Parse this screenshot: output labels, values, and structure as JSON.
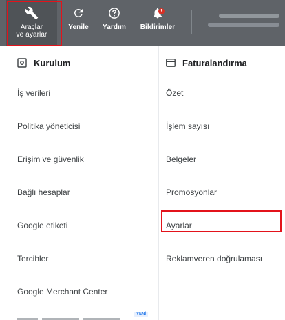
{
  "toolbar": {
    "tools_line1": "Araçlar",
    "tools_line2": "ve ayarlar",
    "refresh": "Yenile",
    "help": "Yardım",
    "notifications": "Bildirimler",
    "notification_badge": "!"
  },
  "left_panel": {
    "title": "Kurulum",
    "items": [
      "İş verileri",
      "Politika yöneticisi",
      "Erişim ve güvenlik",
      "Bağlı hesaplar",
      "Google etiketi",
      "Tercihler",
      "Google Merchant Center"
    ],
    "new_tag": "YENİ"
  },
  "right_panel": {
    "title": "Faturalandırma",
    "items": [
      "Özet",
      "İşlem sayısı",
      "Belgeler",
      "Promosyonlar",
      "Ayarlar",
      "Reklamveren doğrulaması"
    ]
  },
  "colors": {
    "toolbar_bg": "#5f6368",
    "highlight": "#e3131b",
    "text": "#3c4043"
  }
}
